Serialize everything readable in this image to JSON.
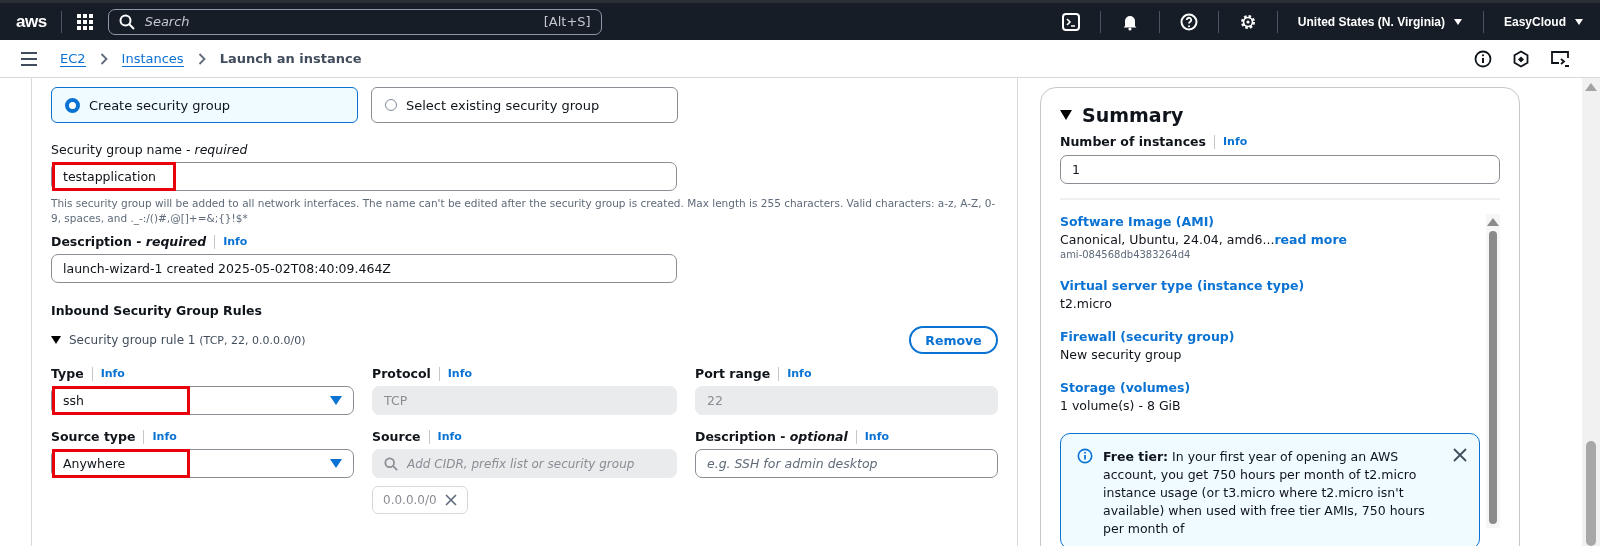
{
  "top_nav": {
    "logo": "aws",
    "search": {
      "placeholder": "Search",
      "shortcut": "[Alt+S]"
    },
    "region": "United States (N. Virginia)",
    "account": "EasyCloud"
  },
  "breadcrumbs": [
    {
      "label": "EC2",
      "link": true
    },
    {
      "label": "Instances",
      "link": true
    },
    {
      "label": "Launch an instance",
      "link": false
    }
  ],
  "security_group": {
    "options": [
      {
        "label": "Create security group",
        "selected": true
      },
      {
        "label": "Select existing security group",
        "selected": false
      }
    ],
    "name": {
      "label": "Security group name - *required*",
      "value": "testapplication",
      "highlighted": true,
      "help": "This security group will be added to all network interfaces. The name can't be edited after the security group is created. Max length is 255 characters. Valid characters: a-z, A-Z, 0-9, spaces, and ._-:/()#,@[]+=&;{}!$*"
    },
    "description": {
      "label": "Description - *required*",
      "info": "Info",
      "value": "launch-wizard-1 created 2025-05-02T08:40:09.464Z"
    }
  },
  "inbound_rules": {
    "title": "Inbound Security Group Rules",
    "rule": {
      "title": "Security group rule 1",
      "detail": "(TCP, 22, 0.0.0.0/0)",
      "expanded": true,
      "remove_button": "Remove"
    },
    "fields": [
      {
        "kind": "select",
        "label": "Type",
        "info": "Info",
        "value": "ssh",
        "highlighted": true
      },
      {
        "kind": "readonly",
        "label": "Protocol",
        "info": "Info",
        "value": "TCP"
      },
      {
        "kind": "readonly",
        "label": "Port range",
        "info": "Info",
        "value": "22"
      },
      {
        "kind": "select",
        "label": "Source type",
        "info": "Info",
        "value": "Anywhere",
        "highlighted": true
      },
      {
        "kind": "search",
        "label": "Source",
        "info": "Info",
        "placeholder": "Add CIDR, prefix list or security group",
        "tokens": [
          "0.0.0.0/0"
        ]
      },
      {
        "kind": "text",
        "label": "Description - *optional*",
        "info": "Info",
        "placeholder": "e.g. SSH for admin desktop"
      }
    ]
  },
  "summary": {
    "title": "Summary",
    "expanded": true,
    "instances": {
      "label": "Number of instances",
      "info": "Info",
      "value": "1"
    },
    "sections": [
      {
        "title": "Software Image (AMI)",
        "value": "Canonical, Ubuntu, 24.04, amd6...",
        "link": "read more",
        "sub": "ami-084568db4383264d4"
      },
      {
        "title": "Virtual server type (instance type)",
        "value": "t2.micro"
      },
      {
        "title": "Firewall (security group)",
        "value": "New security group"
      },
      {
        "title": "Storage (volumes)",
        "value": "1 volume(s) - 8 GiB"
      }
    ],
    "alert": {
      "text": "**Free tier:** In your first year of opening an AWS account, you get 750 hours per month of t2.micro instance usage (or t3.micro where t2.micro isn't available) when used with free tier AMIs, 750 hours per month of"
    }
  }
}
